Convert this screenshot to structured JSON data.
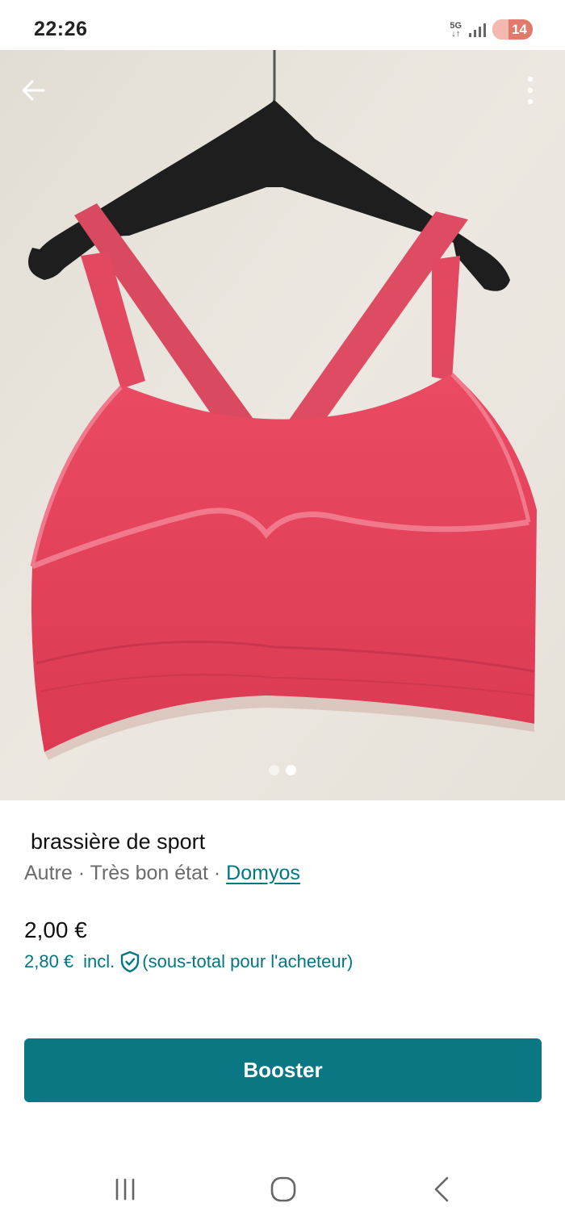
{
  "status_bar": {
    "time": "22:26",
    "network": "5G",
    "battery": "14"
  },
  "gallery": {
    "page_count": 2,
    "active_index": 1,
    "back_icon": "arrow-left-icon",
    "more_icon": "more-vertical-icon"
  },
  "item": {
    "title": "brassière de sport",
    "category": "Autre",
    "condition": "Très bon état",
    "separator": "·",
    "brand": "Domyos",
    "price": "2,00 €",
    "buyer_price": "2,80 €",
    "buyer_incl": "incl.",
    "buyer_note": "(sous-total pour l'acheteur)"
  },
  "actions": {
    "boost_label": "Booster"
  },
  "colors": {
    "accent": "#007782",
    "button": "#0b7782",
    "product": "#e4405a"
  }
}
